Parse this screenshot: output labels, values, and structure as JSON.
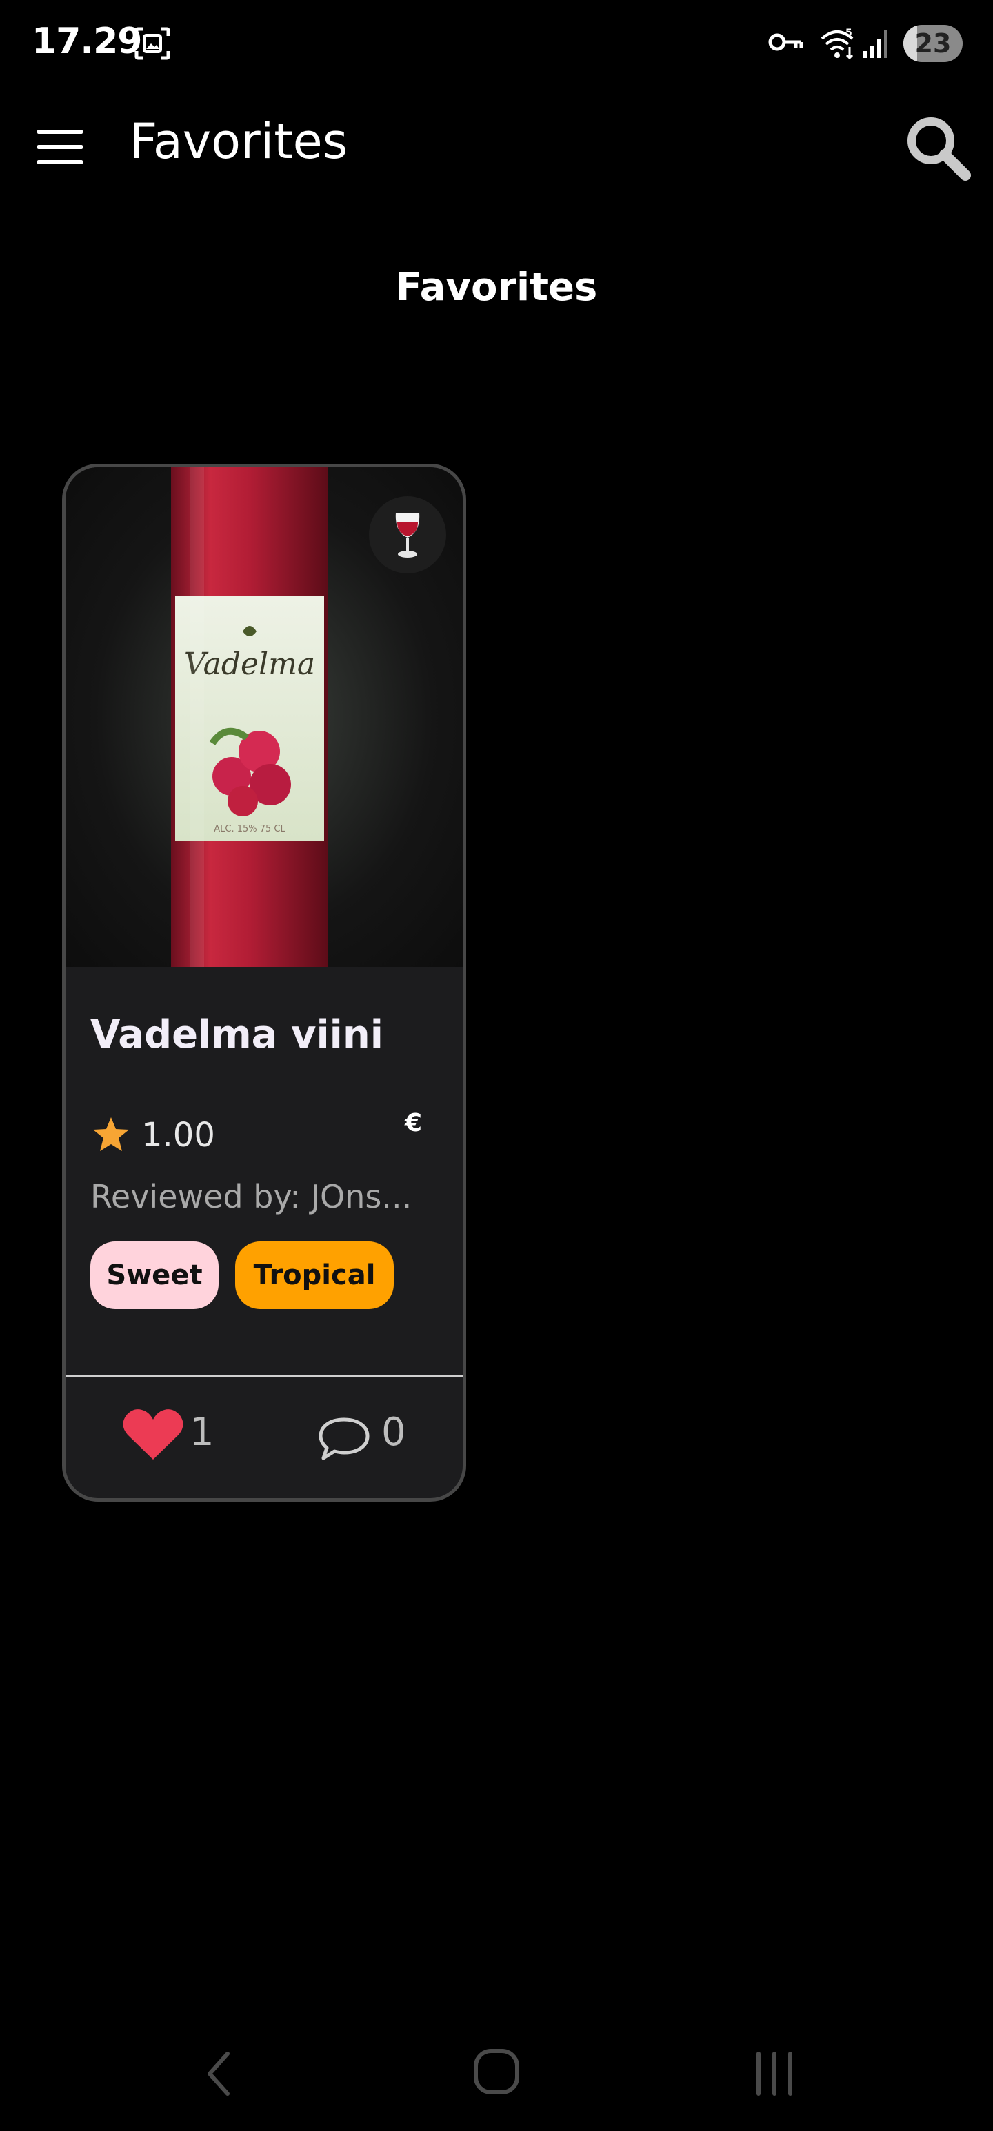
{
  "status_bar": {
    "time": "17.29",
    "battery": "23",
    "battery_level": 0.23,
    "icons": [
      "screenshot-icon",
      "vpn-key-icon",
      "wifi-icon",
      "signal-icon",
      "battery-icon"
    ]
  },
  "app_bar": {
    "title": "Favorites",
    "menu_icon": "hamburger-menu-icon",
    "search_icon": "search-icon"
  },
  "page": {
    "section_title": "Favorites"
  },
  "favorites": [
    {
      "image_alt": "Vadelma",
      "bottle_label": "Vadelma",
      "bottle_small": "ALC. 15% 75 CL",
      "type_icon": "wine-glass-icon",
      "name": "Vadelma viini",
      "rating": "1.00",
      "price": "€",
      "reviewer": "Reviewed by: JOns...",
      "tags": [
        {
          "label": "Sweet",
          "color": "#ffd3dc"
        },
        {
          "label": "Tropical",
          "color": "#ffa100"
        }
      ],
      "likes": "1",
      "comments": "0"
    }
  ],
  "colors": {
    "background": "#000000",
    "card": "#1c1c1e",
    "card_border": "#474747",
    "star": "#f7a534",
    "heart": "#ec3b54"
  },
  "nav_bar": {
    "icons": [
      "back-icon",
      "home-icon",
      "recent-apps-icon"
    ]
  }
}
